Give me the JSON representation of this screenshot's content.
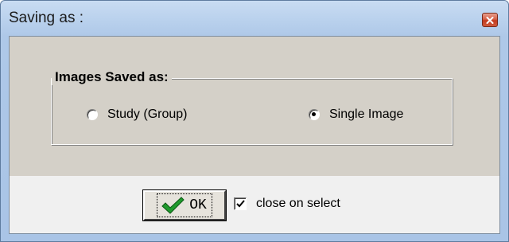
{
  "window": {
    "title": "Saving as :"
  },
  "group": {
    "legend": "Images Saved as:",
    "options": [
      {
        "label": "Study (Group)",
        "checked": false
      },
      {
        "label": "Single Image",
        "checked": true
      }
    ]
  },
  "footer": {
    "ok_label": "OK",
    "close_on_select_label": "close on select",
    "close_on_select_checked": true
  },
  "icons": {
    "close": "close-icon",
    "ok": "checkmark-icon",
    "checkbox": "checkmark-icon"
  },
  "colors": {
    "title_bar": "#bcd3ee",
    "panel": "#d4d0c8",
    "close_button": "#c23b1f",
    "ok_check": "#1f9a2c"
  }
}
